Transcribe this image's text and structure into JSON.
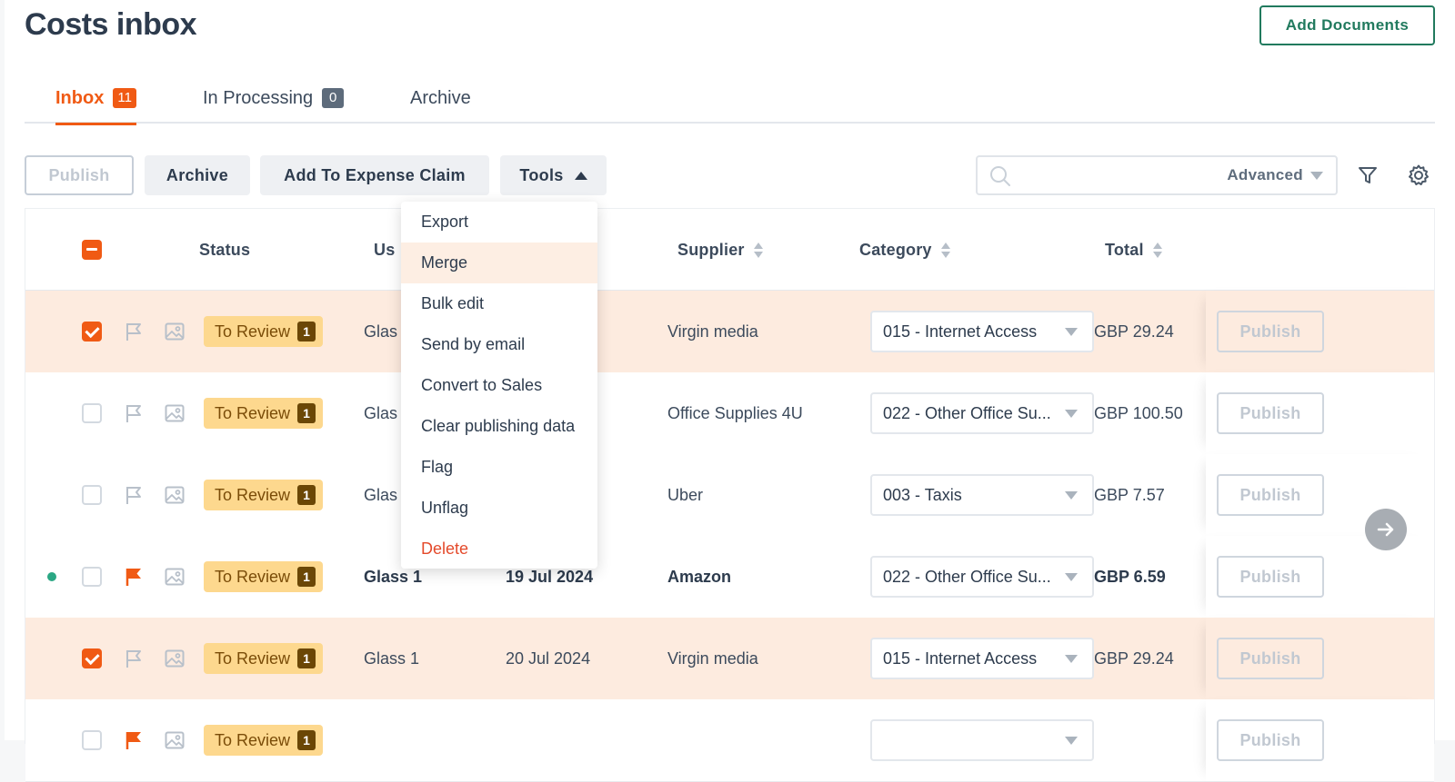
{
  "page": {
    "title": "Costs inbox",
    "add_documents": "Add Documents"
  },
  "tabs": [
    {
      "label": "Inbox",
      "count": "11"
    },
    {
      "label": "In Processing",
      "count": "0"
    },
    {
      "label": "Archive"
    }
  ],
  "toolbar": {
    "publish": "Publish",
    "archive": "Archive",
    "add_expense": "Add To Expense Claim",
    "tools": "Tools",
    "search_placeholder": "",
    "advanced": "Advanced"
  },
  "table": {
    "headers": {
      "status": "Status",
      "user": "Us",
      "supplier": "Supplier",
      "category": "Category",
      "total": "Total"
    },
    "rows": [
      {
        "status": "To Review",
        "count": "1",
        "user": "Glas",
        "date": "",
        "supplier": "Virgin media",
        "category": "015 - Internet Access",
        "total": "GBP 29.24",
        "publish": "Publish"
      },
      {
        "status": "To Review",
        "count": "1",
        "user": "Glas",
        "date": "",
        "supplier": "Office Supplies 4U",
        "category": "022 - Other Office Su...",
        "total": "GBP 100.50",
        "publish": "Publish"
      },
      {
        "status": "To Review",
        "count": "1",
        "user": "Glas",
        "date": "",
        "supplier": "Uber",
        "category": "003 - Taxis",
        "total": "GBP 7.57",
        "publish": "Publish"
      },
      {
        "status": "To Review",
        "count": "1",
        "user": "Glass 1",
        "date": "19 Jul 2024",
        "supplier": "Amazon",
        "category": "022 - Other Office Su...",
        "total": "GBP 6.59",
        "publish": "Publish"
      },
      {
        "status": "To Review",
        "count": "1",
        "user": "Glass 1",
        "date": "20 Jul 2024",
        "supplier": "Virgin media",
        "category": "015 - Internet Access",
        "total": "GBP 29.24",
        "publish": "Publish"
      },
      {
        "status": "To Review",
        "count": "1",
        "user": "",
        "date": "",
        "supplier": "",
        "category": "",
        "total": "",
        "publish": "Publish"
      }
    ]
  },
  "tools_menu": [
    "Export",
    "Merge",
    "Bulk edit",
    "Send by email",
    "Convert to Sales",
    "Clear publishing data",
    "Flag",
    "Unflag",
    "Delete"
  ],
  "colors": {
    "accent": "#f05a14",
    "brand_green": "#217a5e",
    "selected_row": "#fdebdf",
    "badge": "#fdd88e",
    "unread_dot": "#2ba784"
  },
  "icons": {
    "search": "search-icon",
    "filter": "filter-icon",
    "settings": "gear-icon",
    "flag": "flag-icon",
    "image": "image-icon",
    "scroll": "arrow-right-icon"
  }
}
